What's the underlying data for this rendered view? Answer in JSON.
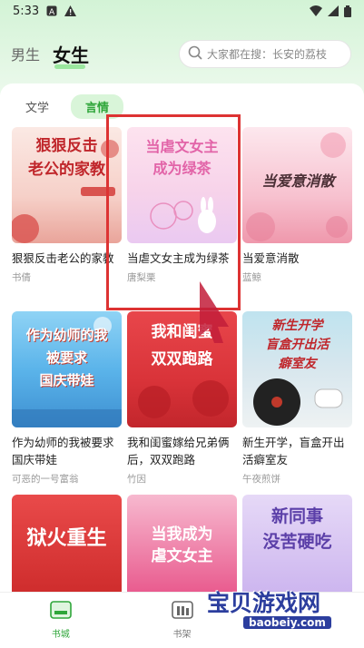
{
  "status_bar": {
    "time": "5:33"
  },
  "header": {
    "gender_tabs": [
      "男生",
      "女生"
    ],
    "search_placeholder": "大家都在搜：长安的荔枝"
  },
  "category_tabs": [
    "文学",
    "言情"
  ],
  "books": [
    {
      "title": "狠狠反击老公的家教",
      "author": "书倩",
      "cover_text": "狠狠反击\n老公的家教"
    },
    {
      "title": "当虐文女主成为绿茶",
      "author": "唐梨栗",
      "cover_text": "当虐文女主\n成为绿茶"
    },
    {
      "title": "当爱意消散",
      "author": "蓝鲸",
      "cover_text": "当爱意消散"
    },
    {
      "title": "作为幼师的我被要求国庆带娃",
      "author": "可恶的一号富翁",
      "cover_text": "作为幼师的我\n被要求\n国庆带娃"
    },
    {
      "title": "我和闺蜜嫁给兄弟俩后，双双跑路",
      "author": "竹因",
      "cover_text": "我和闺蜜\n双双跑路"
    },
    {
      "title": "新生开学，盲盒开出活癖室友",
      "author": "午夜煎饼",
      "cover_text": "新生开学\n盲盒开出活\n癖室友"
    },
    {
      "cover_text": "狱火重生"
    },
    {
      "cover_text": "当我成为\n虐文女主"
    },
    {
      "cover_text": "新同事\n没苦硬吃"
    }
  ],
  "bottom_nav": [
    {
      "label": "书城",
      "icon": "bookstore-icon",
      "active": true
    },
    {
      "label": "书架",
      "icon": "bookshelf-icon",
      "active": false
    }
  ],
  "watermark": {
    "main": "宝贝游戏网",
    "sub": "baobeiy.com"
  },
  "colors": {
    "accent": "#2fa63a",
    "highlight": "#dd3333"
  }
}
